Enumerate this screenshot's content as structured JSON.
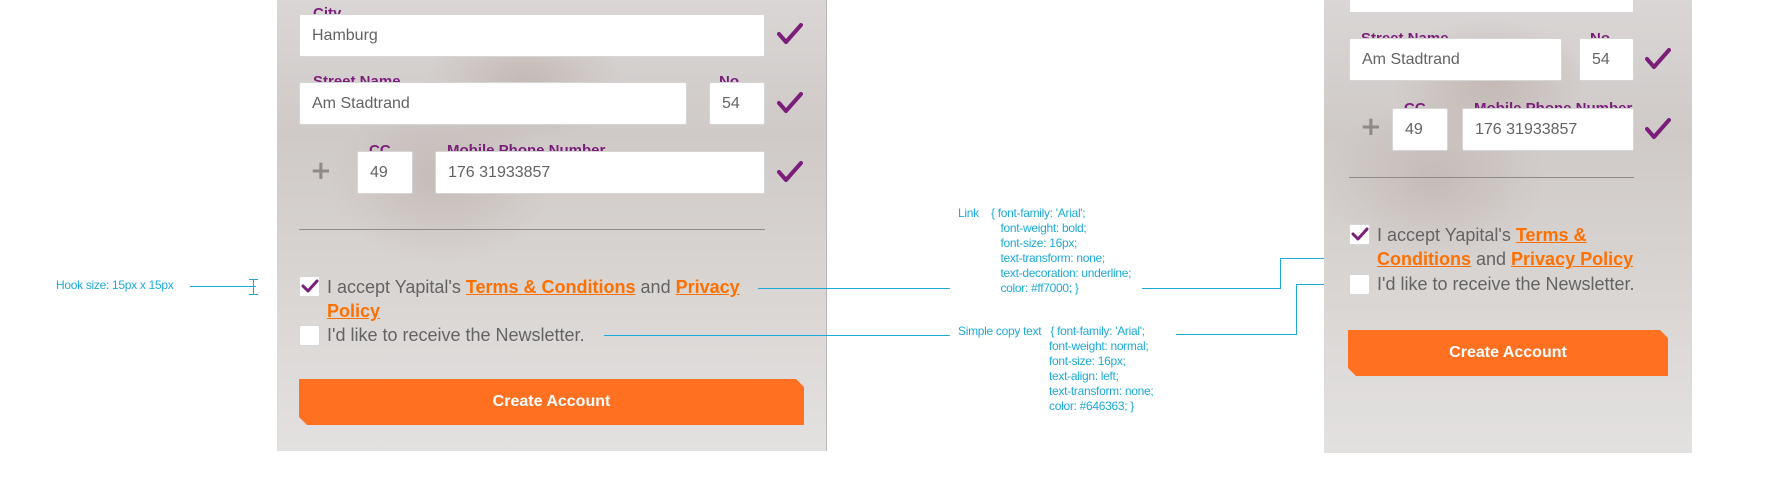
{
  "form": {
    "city_label": "City",
    "city_value": "Hamburg",
    "street_label": "Street Name",
    "street_value": "Am Stadtrand",
    "number_label": "No.",
    "number_value": "54",
    "cc_label": "CC",
    "cc_value": "49",
    "phone_label": "Mobile Phone Number",
    "phone_value": "176 31933857",
    "terms_prefix": "I accept Yapital's ",
    "terms_link": "Terms & Conditions",
    "terms_link_part1": "Terms & ",
    "terms_link_part2": "Conditions",
    "terms_and": " and ",
    "privacy_link": "Privacy Policy",
    "privacy_link_part1": "Privacy ",
    "privacy_link_part2": "Policy",
    "newsletter_label": "I'd like to receive the Newsletter.",
    "create_button": "Create Account"
  },
  "annotations": {
    "hook_size": "Hook size: 15px x 15px",
    "link_spec": "Link    { font-family: 'Arial';\n              font-weight: bold;\n              font-size: 16px;\n              text-transform: none;\n              text-decoration: underline;\n              color: #ff7000; }",
    "copy_spec": "Simple copy text   { font-family: 'Arial';\n                              font-weight: normal;\n                              font-size: 16px;\n                              text-align: left;\n                              text-transform: none;\n                              color: #646363; }"
  },
  "colors": {
    "accent": "#ff7000",
    "label_purple": "#7b1e7a",
    "copy_text": "#646363",
    "annotation": "#1eaad8"
  }
}
